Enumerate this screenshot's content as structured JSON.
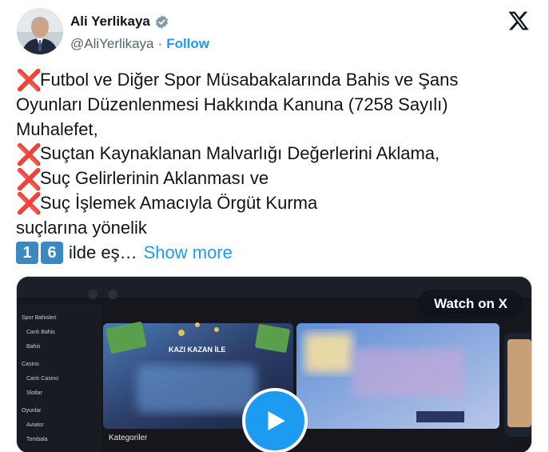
{
  "author": {
    "name": "Ali Yerlikaya",
    "handle": "@AliYerlikaya",
    "separator": "·",
    "follow_label": "Follow"
  },
  "icons": {
    "verified": "verified-badge-icon",
    "brand": "x-logo-icon",
    "cross": "cross-mark-icon",
    "play": "play-icon"
  },
  "tweet": {
    "cross_glyph": "❌",
    "line1": "Futbol ve Diğer Spor Müsabakalarında Bahis ve Şans",
    "line2": "Oyunları Düzenlenmesi Hakkında Kanuna (7258 Sayılı)",
    "line3": "Muhalefet,",
    "line4": "Suçtan Kaynaklanan Malvarlığı Değerlerini Aklama,",
    "line5": "Suç Gelirlerinin Aklanması ve",
    "line6": "Suç İşlemek Amacıyla Örgüt Kurma",
    "line7": "suçlarına yönelik",
    "keycap1": "1",
    "keycap2": "6",
    "line8": "ilde eş…",
    "show_more": "Show more"
  },
  "media": {
    "watch_label": "Watch on X",
    "video_sidebar": [
      "Spor Bahisleri",
      "Canlı Bahis",
      "Bahis",
      "Casino",
      "Canlı Casino",
      "Slotlar",
      "Oyunlar",
      "Aviator",
      "Tombala"
    ],
    "video_banner_text": "KAZI KAZAN İLE",
    "video_section_label": "Kategoriler"
  },
  "colors": {
    "accent": "#1d9bf0",
    "text": "#0f1419",
    "muted": "#536471",
    "cross": "#e0245e",
    "keycap": "#3b88c3"
  }
}
